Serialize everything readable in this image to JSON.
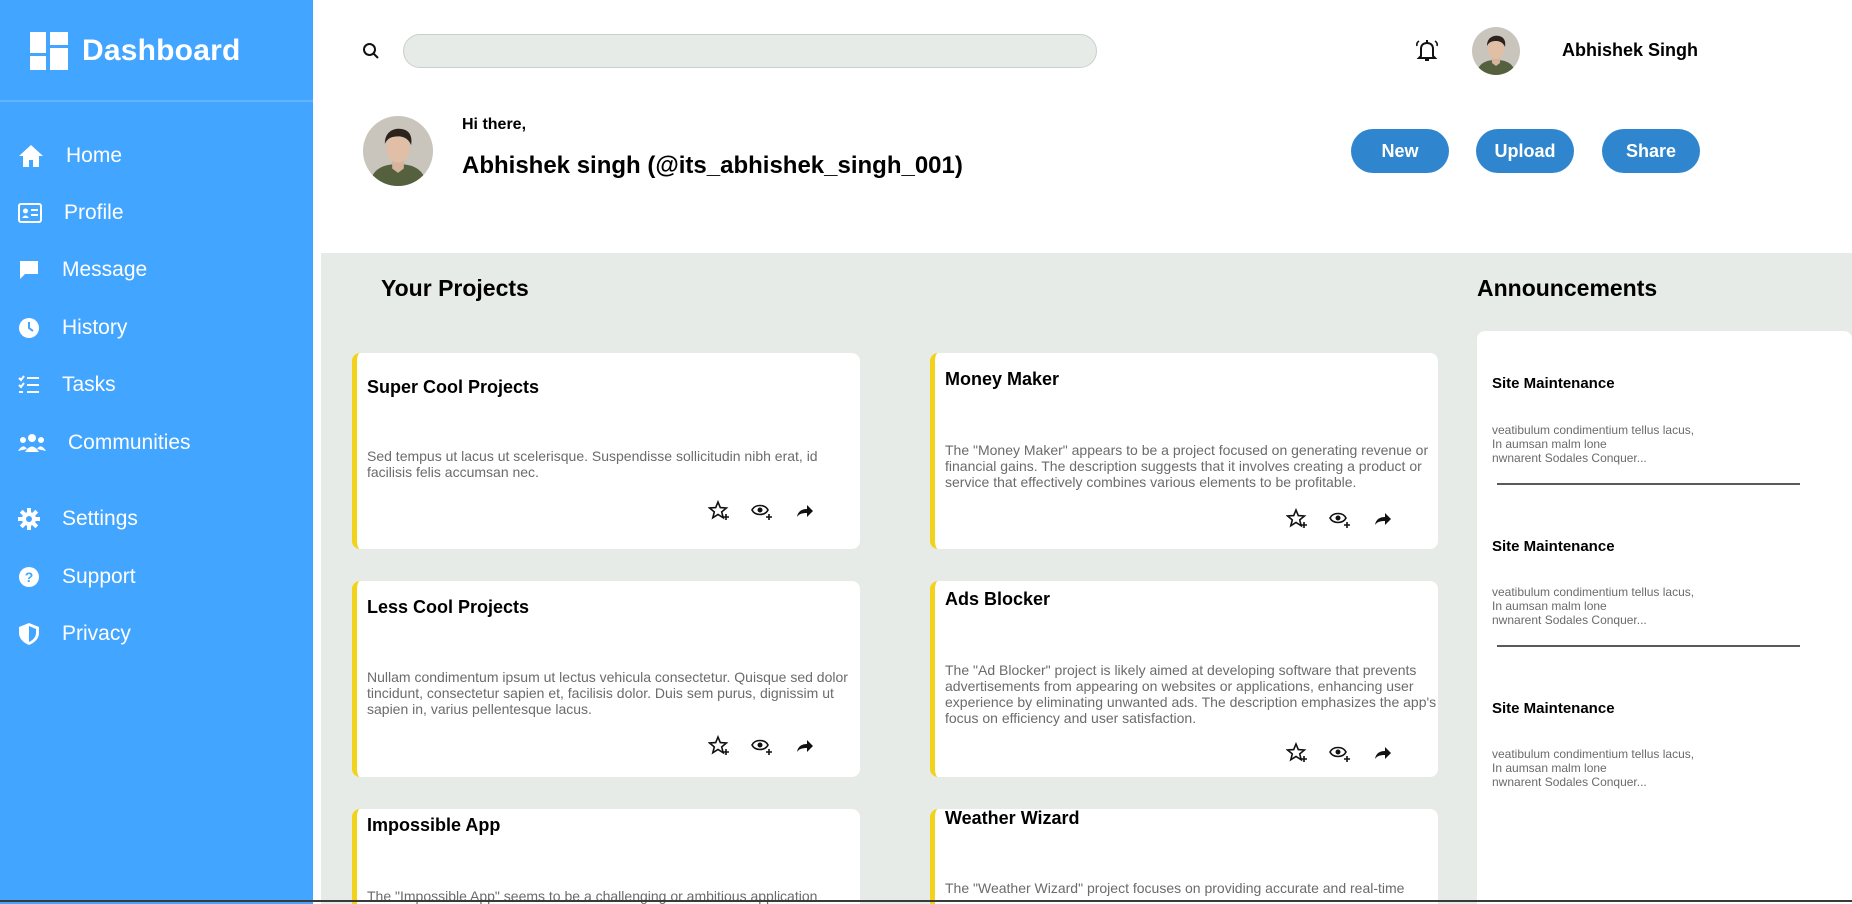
{
  "brand": {
    "title": "Dashboard",
    "logo_icon": "dashboard-grid-icon"
  },
  "sidebar": {
    "items": [
      {
        "label": "Home",
        "icon": "home-icon"
      },
      {
        "label": "Profile",
        "icon": "id-card-icon"
      },
      {
        "label": "Message",
        "icon": "message-icon"
      },
      {
        "label": "History",
        "icon": "clock-icon"
      },
      {
        "label": "Tasks",
        "icon": "tasks-icon"
      },
      {
        "label": "Communities",
        "icon": "users-icon"
      },
      {
        "label": "Settings",
        "icon": "gear-icon"
      },
      {
        "label": "Support",
        "icon": "question-icon"
      },
      {
        "label": "Privacy",
        "icon": "shield-icon"
      }
    ]
  },
  "topbar": {
    "search_value": "",
    "username": "Abhishek Singh"
  },
  "greeting": {
    "hi": "Hi there,",
    "name": "Abhishek singh (@its_abhishek_singh_001)"
  },
  "actions": {
    "new": "New",
    "upload": "Upload",
    "share": "Share"
  },
  "projects": {
    "title": "Your Projects",
    "items": [
      {
        "title": "Super Cool Projects",
        "description": "Sed tempus ut lacus ut scelerisque. Suspendisse sollicitudin nibh erat, id facilisis felis accumsan nec."
      },
      {
        "title": "Money Maker",
        "description": "The \"Money Maker\" appears to be a project focused on generating revenue or financial gains. The description suggests that it involves creating a product or service that effectively combines various elements to be profitable."
      },
      {
        "title": "Less Cool Projects",
        "description": "Nullam condimentum ipsum ut lectus vehicula consectetur. Quisque sed dolor tincidunt, consectetur sapien et, facilisis dolor. Duis sem purus, dignissim ut sapien in, varius pellentesque lacus."
      },
      {
        "title": "Ads Blocker",
        "description": "The \"Ad Blocker\" project is likely aimed at developing software that prevents advertisements from appearing on websites or applications, enhancing user experience by eliminating unwanted ads. The description emphasizes the app's focus on efficiency and user satisfaction."
      },
      {
        "title": "Impossible App",
        "description": "The \"Impossible App\" seems to be a challenging or ambitious application project"
      },
      {
        "title": "Weather Wizard",
        "description": "The \"Weather Wizard\" project focuses on providing accurate and real-time"
      }
    ],
    "action_icons": [
      "star-icon",
      "eye-plus-icon",
      "share-arrow-icon"
    ]
  },
  "announcements": {
    "title": "Announcements",
    "items": [
      {
        "title": "Site Maintenance",
        "lines": [
          "veatibulum condimentium tellus lacus,",
          "In aumsan malm lone",
          "nwnarent Sodales Conquer..."
        ]
      },
      {
        "title": "Site Maintenance",
        "lines": [
          "veatibulum condimentium tellus lacus,",
          "In aumsan malm lone",
          "nwnarent Sodales Conquer..."
        ]
      },
      {
        "title": "Site Maintenance",
        "lines": [
          "veatibulum condimentium tellus lacus,",
          "In aumsan malm lone",
          "nwnarent Sodales Conquer..."
        ]
      }
    ]
  },
  "colors": {
    "sidebar": "#42a5ff",
    "main_bg": "#e6ebe7",
    "button": "#2f86cf",
    "card_accent": "#f2d21b"
  }
}
